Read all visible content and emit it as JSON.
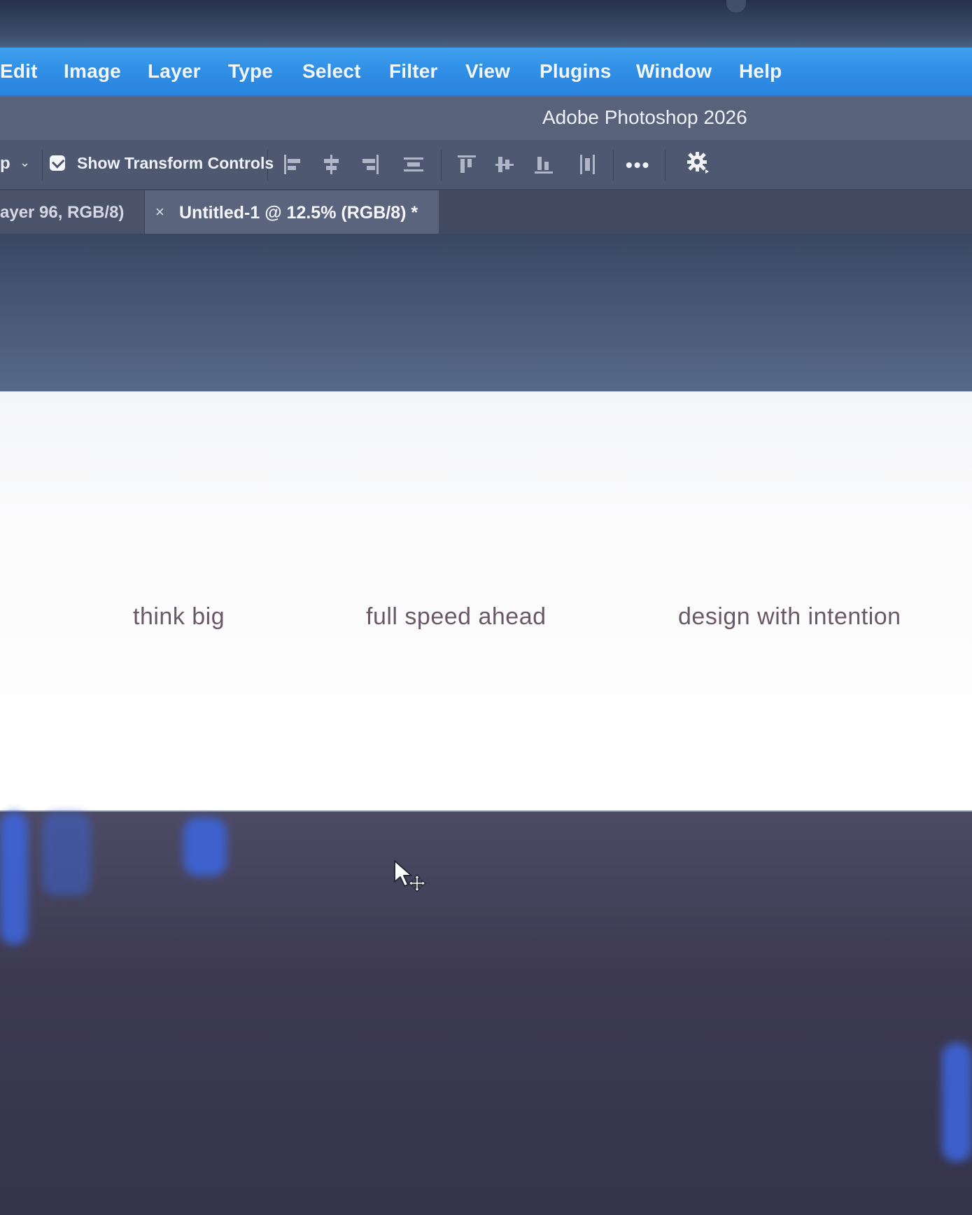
{
  "menubar": {
    "items": [
      "Edit",
      "Image",
      "Layer",
      "Type",
      "Select",
      "Filter",
      "View",
      "Plugins",
      "Window",
      "Help"
    ]
  },
  "titlebar": {
    "title": "Adobe Photoshop 2026"
  },
  "options": {
    "tool_preset_partial": "p",
    "show_transform_controls_label": "Show Transform Controls",
    "show_transform_controls_checked": true,
    "more_label": "•••"
  },
  "tabs": [
    {
      "label": "ayer 96, RGB/8)",
      "active": false
    },
    {
      "label": "Untitled-1 @ 12.5% (RGB/8) *",
      "active": true,
      "close_glyph": "×"
    }
  ],
  "canvas": {
    "texts": [
      "think big",
      "full speed ahead",
      "design with intention"
    ]
  },
  "colors": {
    "menubar": "#2f8ee5",
    "canvas": "#ffffff",
    "canvas_text": "#6b5866"
  },
  "icons": {
    "cursor": "move-tool-cursor-icon",
    "gear": "gear-icon",
    "checkbox": "checkbox-checked-icon"
  }
}
